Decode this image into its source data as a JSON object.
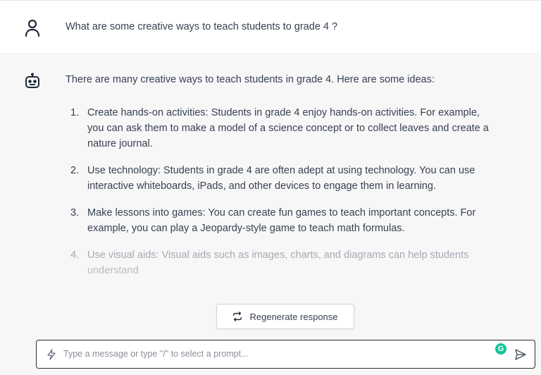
{
  "conversation": {
    "user_message": "What are some creative ways to teach students to grade 4 ?",
    "assistant": {
      "intro": "There are many creative ways to teach students in grade 4. Here are some ideas:",
      "items": [
        {
          "number": "1.",
          "text": "Create hands-on activities: Students in grade 4 enjoy hands-on activities. For example, you can ask them to make a model of a science concept or to collect leaves and create a nature journal."
        },
        {
          "number": "2.",
          "text": "Use technology: Students in grade 4 are often adept at using technology. You can use interactive whiteboards, iPads, and other devices to engage them in learning."
        },
        {
          "number": "3.",
          "text": "Make lessons into games: You can create fun games to teach important concepts. For example, you can play a Jeopardy-style game to teach math formulas."
        },
        {
          "number": "4.",
          "text": "Use visual aids: Visual aids such as images, charts, and diagrams can help students understand"
        }
      ]
    }
  },
  "regenerate": {
    "label": "Regenerate response",
    "icon": "repeat-icon"
  },
  "composer": {
    "placeholder": "Type a message or type \"/\" to select a prompt...",
    "value": "",
    "prompt_icon": "lightning-icon",
    "grammar_badge": "G",
    "send_icon": "send-icon"
  },
  "icons": {
    "user": "user-icon",
    "assistant": "bot-icon"
  },
  "colors": {
    "conversation_bg": "#f7f7f8",
    "text": "#374151",
    "grammar_badge": "#15c39a",
    "composer_border": "#2b2b2b"
  }
}
